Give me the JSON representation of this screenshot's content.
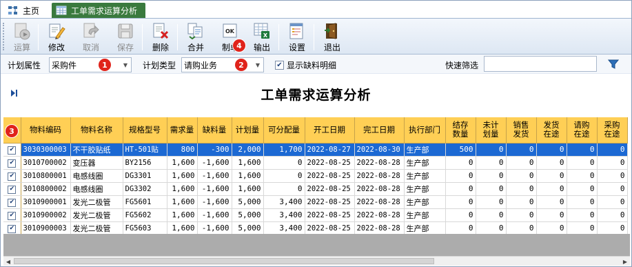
{
  "tabs": [
    {
      "label": "主页",
      "icon": "sitemap-icon"
    },
    {
      "label": "工单需求运算分析",
      "icon": "table-icon"
    }
  ],
  "toolbar": {
    "buttons": [
      {
        "label": "运算",
        "icon": "play-icon",
        "enabled": false
      },
      {
        "label": "修改",
        "icon": "edit-icon",
        "enabled": true
      },
      {
        "label": "取消",
        "icon": "undo-icon",
        "enabled": false
      },
      {
        "label": "保存",
        "icon": "save-icon",
        "enabled": false
      },
      {
        "label": "删除",
        "icon": "delete-icon",
        "enabled": true
      },
      {
        "label": "合并",
        "icon": "merge-icon",
        "enabled": true
      },
      {
        "label": "制单",
        "icon": "ok-document-icon",
        "enabled": true
      },
      {
        "label": "输出",
        "icon": "excel-export-icon",
        "enabled": true
      },
      {
        "label": "设置",
        "icon": "settings-icon",
        "enabled": true
      },
      {
        "label": "退出",
        "icon": "exit-icon",
        "enabled": true
      }
    ]
  },
  "filters": {
    "plan_attr_label": "计划属性",
    "plan_attr_value": "采购件",
    "plan_type_label": "计划类型",
    "plan_type_value": "请购业务",
    "show_shortage_label": "显示缺料明细",
    "show_shortage_checked": true,
    "quick_filter_label": "快速筛选",
    "quick_filter_value": ""
  },
  "badges": [
    "1",
    "2",
    "3",
    "4"
  ],
  "page_title": "工单需求运算分析",
  "colors": {
    "header_bg": "#ffcf55",
    "selected_row": "#1c69d3",
    "badge": "#e0231b",
    "active_tab": "#3a7a3e"
  },
  "grid": {
    "columns": [
      "物料编码",
      "物料名称",
      "规格型号",
      "需求量",
      "缺料量",
      "计划量",
      "可分配量",
      "开工日期",
      "完工日期",
      "执行部门",
      "结存\n数量",
      "未计\n划量",
      "销售\n发货",
      "发货\n在途",
      "请购\n在途",
      "采购\n在途"
    ],
    "rows": [
      {
        "checked": true,
        "selected": true,
        "cells": [
          "3030300003",
          "不干胶贴纸",
          "HT-501贴",
          "800",
          "-300",
          "2,000",
          "1,700",
          "2022-08-27",
          "2022-08-30",
          "生产部",
          "500",
          "0",
          "0",
          "0",
          "0",
          "0"
        ]
      },
      {
        "checked": true,
        "selected": false,
        "cells": [
          "3010700002",
          "变压器",
          "BY2156",
          "1,600",
          "-1,600",
          "1,600",
          "0",
          "2022-08-25",
          "2022-08-28",
          "生产部",
          "0",
          "0",
          "0",
          "0",
          "0",
          "0"
        ]
      },
      {
        "checked": true,
        "selected": false,
        "cells": [
          "3010800001",
          "电感线圈",
          "DG3301",
          "1,600",
          "-1,600",
          "1,600",
          "0",
          "2022-08-25",
          "2022-08-28",
          "生产部",
          "0",
          "0",
          "0",
          "0",
          "0",
          "0"
        ]
      },
      {
        "checked": true,
        "selected": false,
        "cells": [
          "3010800002",
          "电感线圈",
          "DG3302",
          "1,600",
          "-1,600",
          "1,600",
          "0",
          "2022-08-25",
          "2022-08-28",
          "生产部",
          "0",
          "0",
          "0",
          "0",
          "0",
          "0"
        ]
      },
      {
        "checked": true,
        "selected": false,
        "cells": [
          "3010900001",
          "发光二极管",
          "FG5601",
          "1,600",
          "-1,600",
          "5,000",
          "3,400",
          "2022-08-25",
          "2022-08-28",
          "生产部",
          "0",
          "0",
          "0",
          "0",
          "0",
          "0"
        ]
      },
      {
        "checked": true,
        "selected": false,
        "cells": [
          "3010900002",
          "发光二极管",
          "FG5602",
          "1,600",
          "-1,600",
          "5,000",
          "3,400",
          "2022-08-25",
          "2022-08-28",
          "生产部",
          "0",
          "0",
          "0",
          "0",
          "0",
          "0"
        ]
      },
      {
        "checked": true,
        "selected": false,
        "cells": [
          "3010900003",
          "发光二极管",
          "FG5603",
          "1,600",
          "-1,600",
          "5,000",
          "3,400",
          "2022-08-25",
          "2022-08-28",
          "生产部",
          "0",
          "0",
          "0",
          "0",
          "0",
          "0"
        ]
      }
    ]
  }
}
